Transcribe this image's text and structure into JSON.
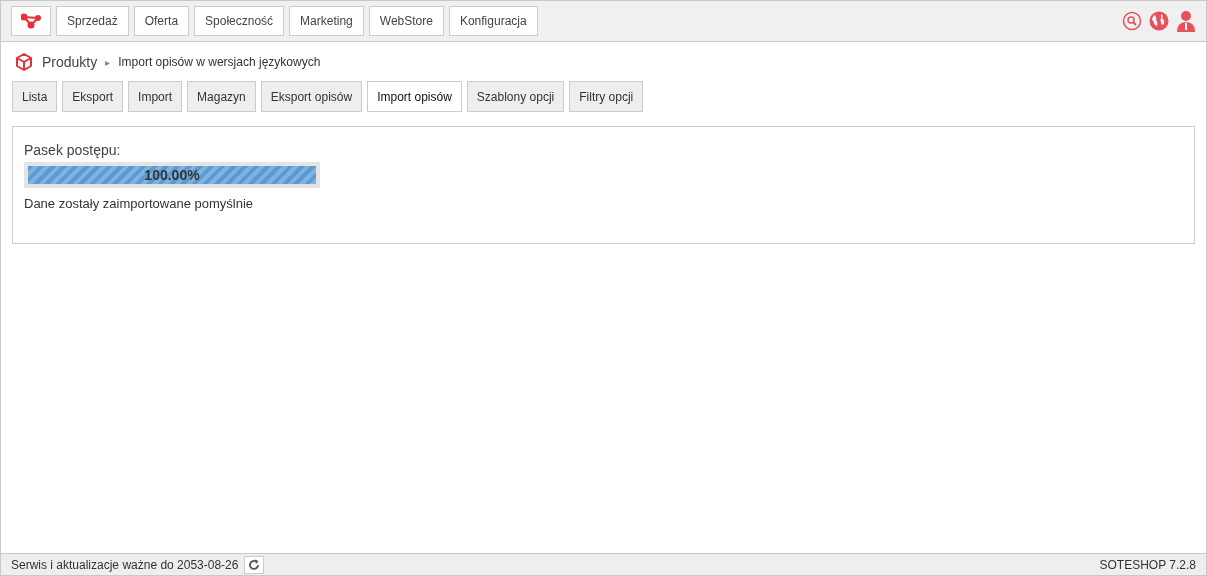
{
  "top_menu": [
    {
      "label": "Sprzedaż"
    },
    {
      "label": "Oferta"
    },
    {
      "label": "Społeczność"
    },
    {
      "label": "Marketing"
    },
    {
      "label": "WebStore"
    },
    {
      "label": "Konfiguracja"
    }
  ],
  "breadcrumb": {
    "section": "Produkty",
    "separator": "▸",
    "page": "Import opisów w wersjach językowych"
  },
  "tabs": [
    {
      "label": "Lista",
      "selected": false
    },
    {
      "label": "Eksport",
      "selected": false
    },
    {
      "label": "Import",
      "selected": false
    },
    {
      "label": "Magazyn",
      "selected": false
    },
    {
      "label": "Eksport opisów",
      "selected": false
    },
    {
      "label": "Import opisów",
      "selected": true
    },
    {
      "label": "Szablony opcji",
      "selected": false
    },
    {
      "label": "Filtry opcji",
      "selected": false
    }
  ],
  "progress": {
    "label": "Pasek postępu:",
    "level": 1,
    "reading": "100.00%",
    "message": "Dane zostały zaimportowane pomyślnie"
  },
  "status_bar": {
    "license": "Serwis i aktualizacje ważne do 2053-08-26",
    "version": "SOTESHOP 7.2.8"
  }
}
